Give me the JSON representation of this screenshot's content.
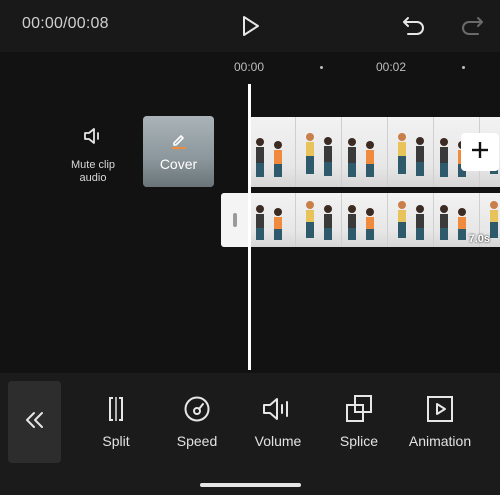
{
  "header": {
    "time": "00:00/00:08",
    "play_icon": "play-icon",
    "undo_icon": "undo-icon",
    "redo_icon": "redo-icon"
  },
  "timeline": {
    "ruler": [
      "00:00",
      "00:02"
    ],
    "mute_label": "Mute clip\naudio",
    "cover_label": "Cover",
    "duration": "7.0s"
  },
  "toolbar": {
    "back_icon": "double-chevron-left-icon",
    "tools": [
      {
        "label": "Split",
        "icon": "split-icon"
      },
      {
        "label": "Speed",
        "icon": "speed-icon"
      },
      {
        "label": "Volume",
        "icon": "volume-icon"
      },
      {
        "label": "Splice",
        "icon": "splice-icon"
      },
      {
        "label": "Animation",
        "icon": "animation-icon"
      }
    ]
  },
  "colors": {
    "background": "#121212",
    "bar": "#1b1b1b",
    "accent": "#ffffff"
  }
}
